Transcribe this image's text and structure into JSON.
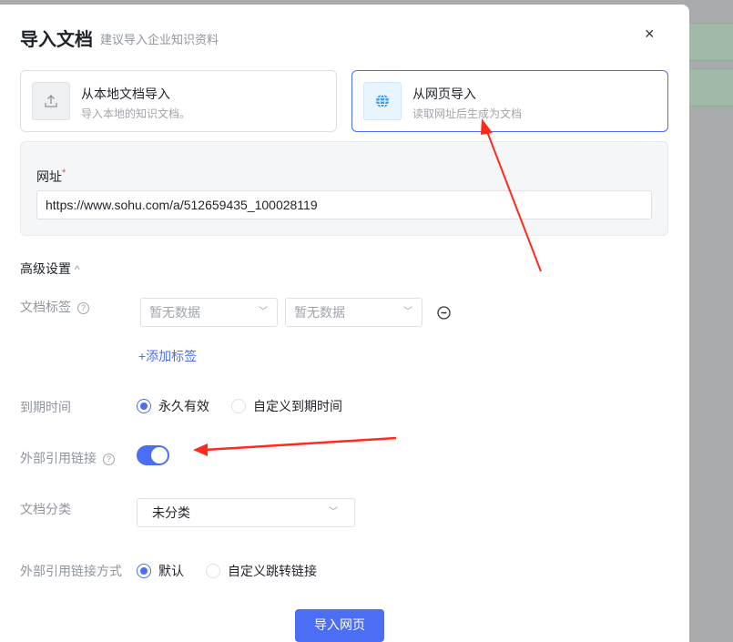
{
  "dialog": {
    "title": "导入文档",
    "subtitle": "建议导入企业知识资料",
    "close": "×"
  },
  "sources": [
    {
      "title": "从本地文档导入",
      "desc": "导入本地的知识文档。",
      "icon": "upload-icon",
      "selected": false
    },
    {
      "title": "从网页导入",
      "desc": "读取网址后生成为文档",
      "icon": "globe-icon",
      "selected": true
    }
  ],
  "url": {
    "label": "网址",
    "required_mark": "*",
    "value": "https://www.sohu.com/a/512659435_100028119"
  },
  "advanced": {
    "label": "高级设置",
    "chevron": "^"
  },
  "tags": {
    "label": "文档标签",
    "help": "?",
    "select1_placeholder": "暂无数据",
    "select2_placeholder": "暂无数据",
    "add_label": "+添加标签"
  },
  "expiry": {
    "label": "到期时间",
    "options": [
      "永久有效",
      "自定义到期时间"
    ],
    "selected": 0
  },
  "external_link": {
    "label": "外部引用链接",
    "help": "?",
    "enabled": true
  },
  "category": {
    "label": "文档分类",
    "value": "未分类"
  },
  "link_mode": {
    "label": "外部引用链接方式",
    "options": [
      "默认",
      "自定义跳转链接"
    ],
    "selected": 0
  },
  "submit_label": "导入网页",
  "colors": {
    "accent": "#4c6ef5",
    "annotation": "#ff2a1a"
  }
}
